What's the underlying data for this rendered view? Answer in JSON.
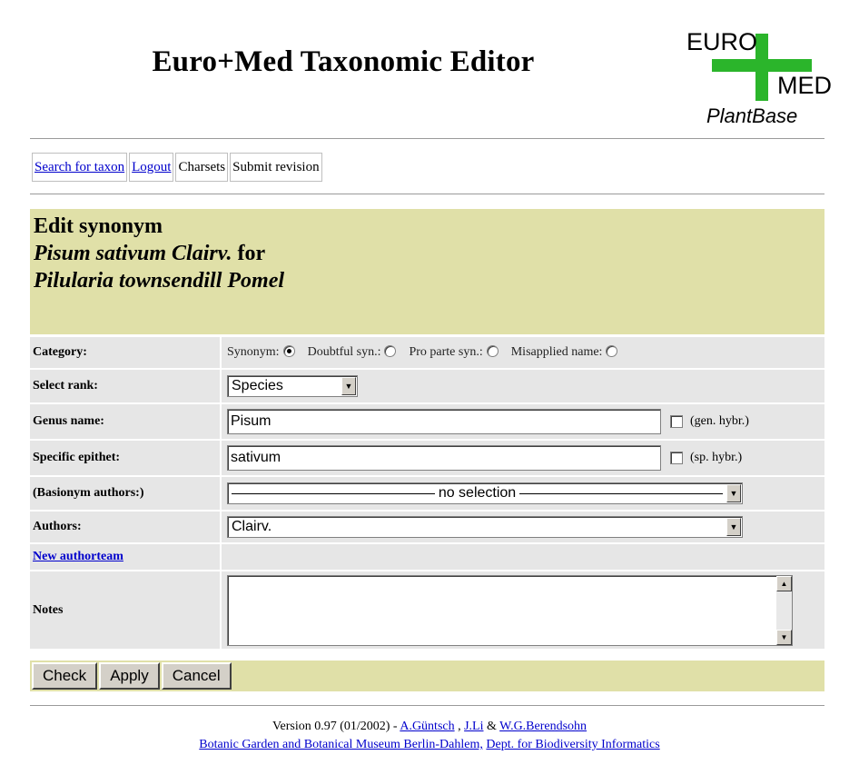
{
  "header": {
    "title": "Euro+Med Taxonomic Editor"
  },
  "logo": {
    "euro": "EURO",
    "med": "MED",
    "plantbase": "PlantBase",
    "cross_color": "#2bb52b"
  },
  "nav": {
    "search": "Search for taxon",
    "logout": "Logout",
    "charsets": "Charsets",
    "submit": "Submit revision"
  },
  "title_block": {
    "line1": "Edit synonym",
    "line2_name": "Pisum sativum Clairv.",
    "line2_for": " for",
    "line3": "Pilularia townsendill Pomel"
  },
  "form": {
    "category_label": "Category:",
    "category_options": [
      {
        "label": "Synonym:",
        "checked": true
      },
      {
        "label": "Doubtful syn.:",
        "checked": false
      },
      {
        "label": "Pro parte syn.:",
        "checked": false
      },
      {
        "label": "Misapplied name:",
        "checked": false
      }
    ],
    "rank_label": "Select rank:",
    "rank_value": "Species",
    "genus_label": "Genus name:",
    "genus_value": "Pisum",
    "genus_hybrid": "(gen. hybr.)",
    "epithet_label": "Specific epithet:",
    "epithet_value": "sativum",
    "epithet_hybrid": "(sp. hybr.)",
    "basionym_label": "(Basionym authors:)",
    "basionym_value": "no selection",
    "authors_label": "Authors:",
    "authors_value": "Clairv.",
    "new_authorteam": "New authorteam",
    "notes_label": "Notes",
    "notes_value": ""
  },
  "buttons": {
    "check": "Check",
    "apply": "Apply",
    "cancel": "Cancel"
  },
  "footer": {
    "version": "Version 0.97 (01/2002) - ",
    "author1": "A.Güntsch",
    "sep1": " , ",
    "author2": "J.Li",
    "sep2": " & ",
    "author3": "W.G.Berendsohn",
    "org": "Botanic Garden and Botanical Museum Berlin-Dahlem,",
    "dept": "Dept. for Biodiversity Informatics"
  },
  "colors": {
    "title_bg": "#e0e0a8",
    "row_bg": "#e6e6e6",
    "link": "#0000cc"
  }
}
